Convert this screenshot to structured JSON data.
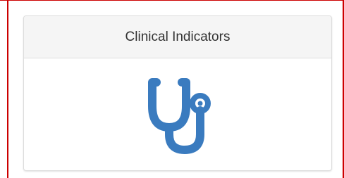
{
  "tile": {
    "title": "Clinical Indicators",
    "icon": "stethoscope-icon",
    "icon_color": "#3a7bbf"
  },
  "colors": {
    "frame_border": "#cc0000",
    "header_bg": "#f5f5f5",
    "card_border": "#dddddd"
  }
}
